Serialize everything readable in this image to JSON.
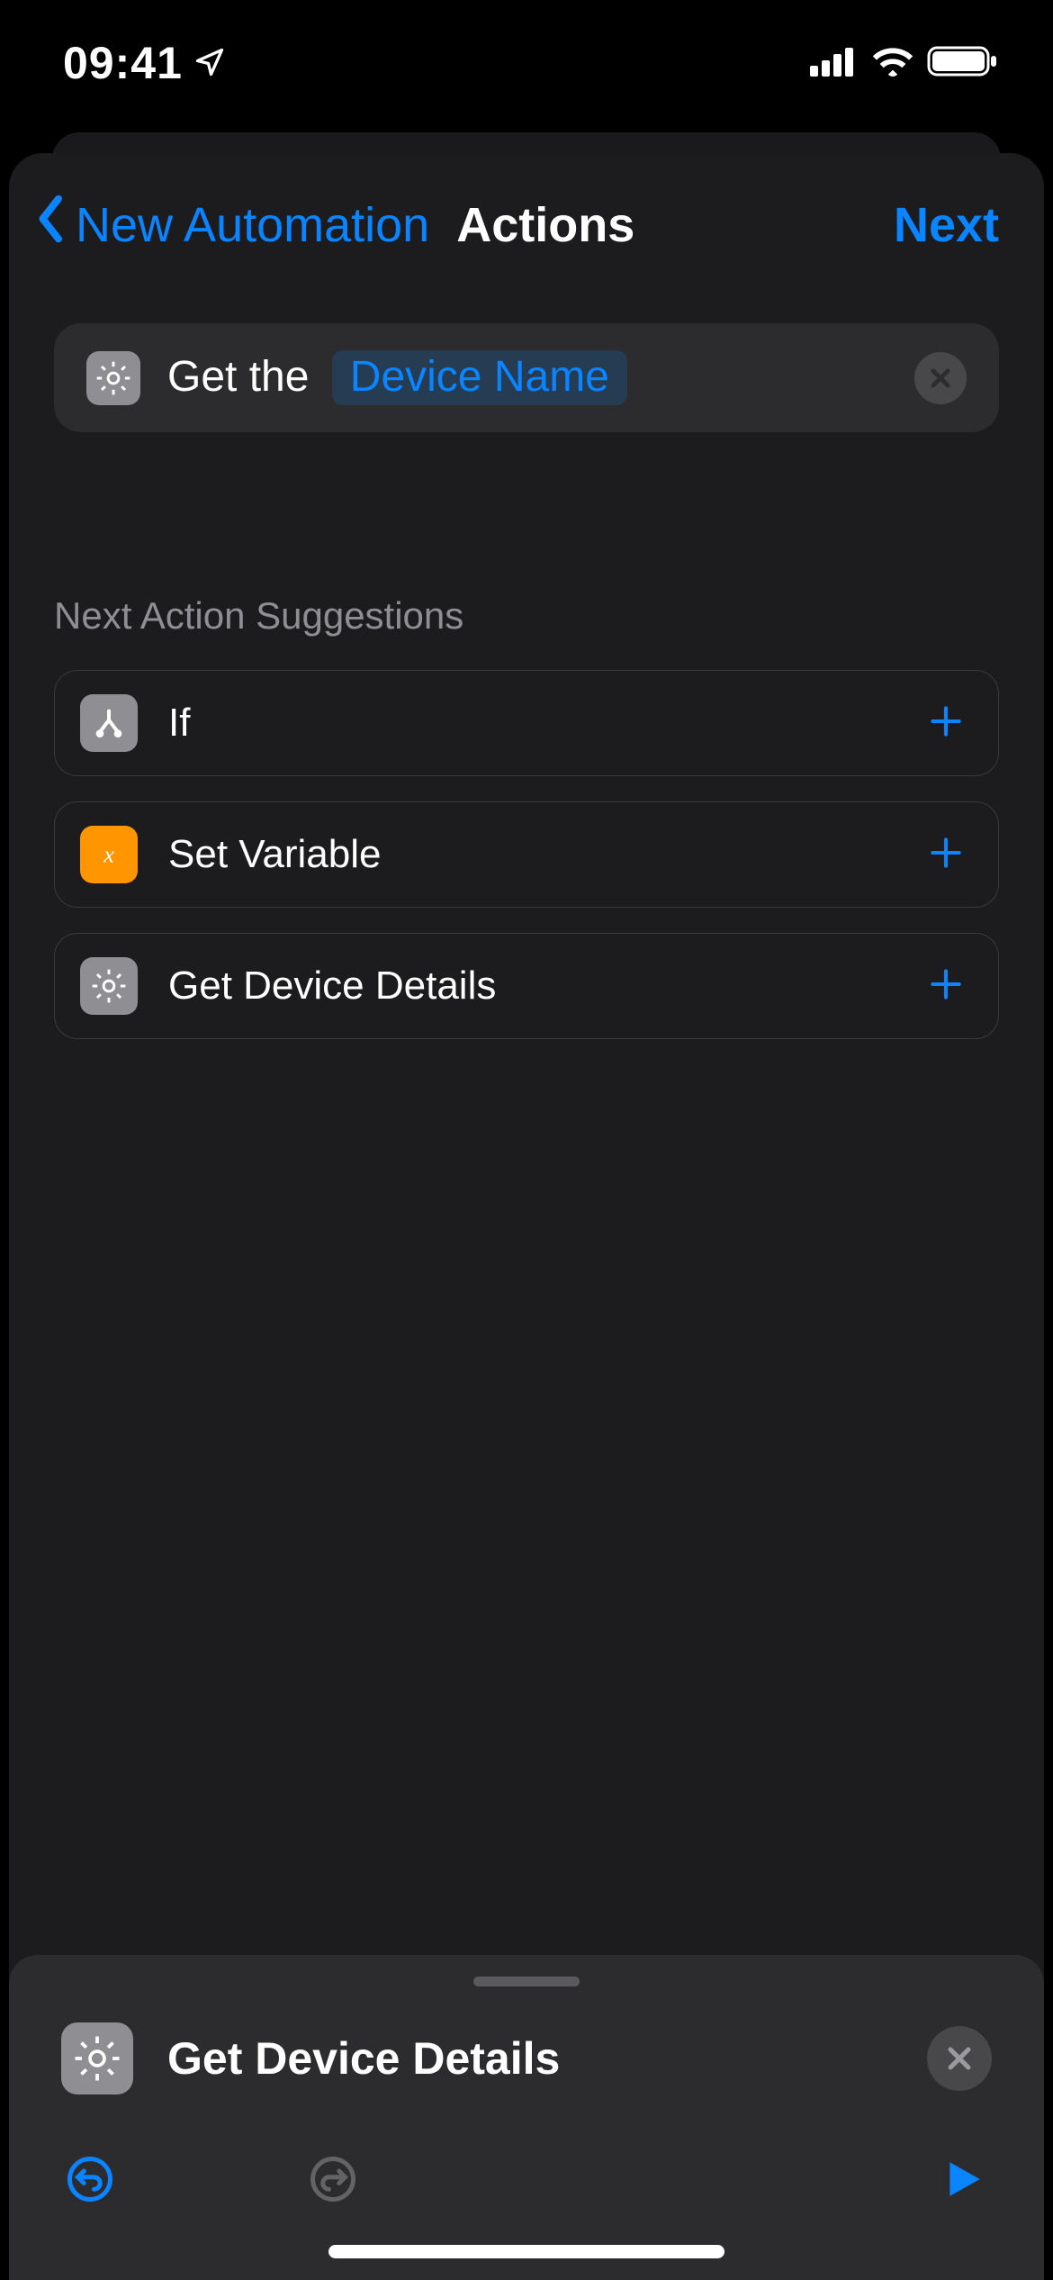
{
  "status_bar": {
    "time": "09:41"
  },
  "nav": {
    "back_label": "New Automation",
    "title": "Actions",
    "next_label": "Next"
  },
  "action": {
    "prefix": "Get the",
    "param": "Device Name"
  },
  "suggestions_title": "Next Action Suggestions",
  "suggestions": [
    {
      "label": "If",
      "icon": "branch",
      "color": "grey"
    },
    {
      "label": "Set Variable",
      "icon": "x-var",
      "color": "orange"
    },
    {
      "label": "Get Device Details",
      "icon": "gear",
      "color": "grey"
    }
  ],
  "panel": {
    "title": "Get Device Details"
  }
}
